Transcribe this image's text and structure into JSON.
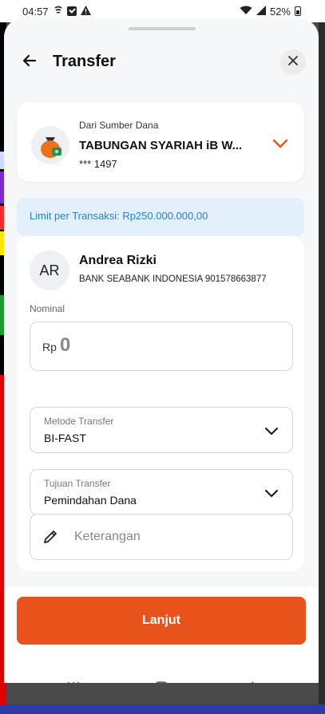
{
  "status_bar": {
    "time": "04:57",
    "battery": "52%",
    "icons": [
      "notification-icon",
      "check-icon",
      "warning-icon",
      "wifi-icon",
      "signal-icon",
      "battery-icon"
    ]
  },
  "header": {
    "title": "Transfer",
    "icons": {
      "back": "arrow-left-icon",
      "close": "close-icon"
    }
  },
  "source": {
    "label": "Dari Sumber Dana",
    "name": "TABUNGAN SYARIAH iB W...",
    "account": "*** 1497",
    "icon": "money-bag-icon"
  },
  "limit": {
    "text": "Limit per Transaksi: Rp250.000.000,00"
  },
  "recipient": {
    "initials": "AR",
    "name": "Andrea Rizki",
    "bank": "BANK SEABANK INDONESIA 901578663877"
  },
  "nominal": {
    "label": "Nominal",
    "currency": "Rp",
    "value": "0"
  },
  "method": {
    "label": "Metode Transfer",
    "value": "BI-FAST"
  },
  "purpose": {
    "label": "Tujuan Transfer",
    "value": "Pemindahan Dana"
  },
  "note": {
    "placeholder": "Keterangan"
  },
  "actions": {
    "next_label": "Lanjut"
  },
  "colors": {
    "accent": "#e8531c",
    "limit_bg": "#e3f0fb",
    "limit_text": "#2a7fc4",
    "chevron_accent": "#e8531c"
  }
}
